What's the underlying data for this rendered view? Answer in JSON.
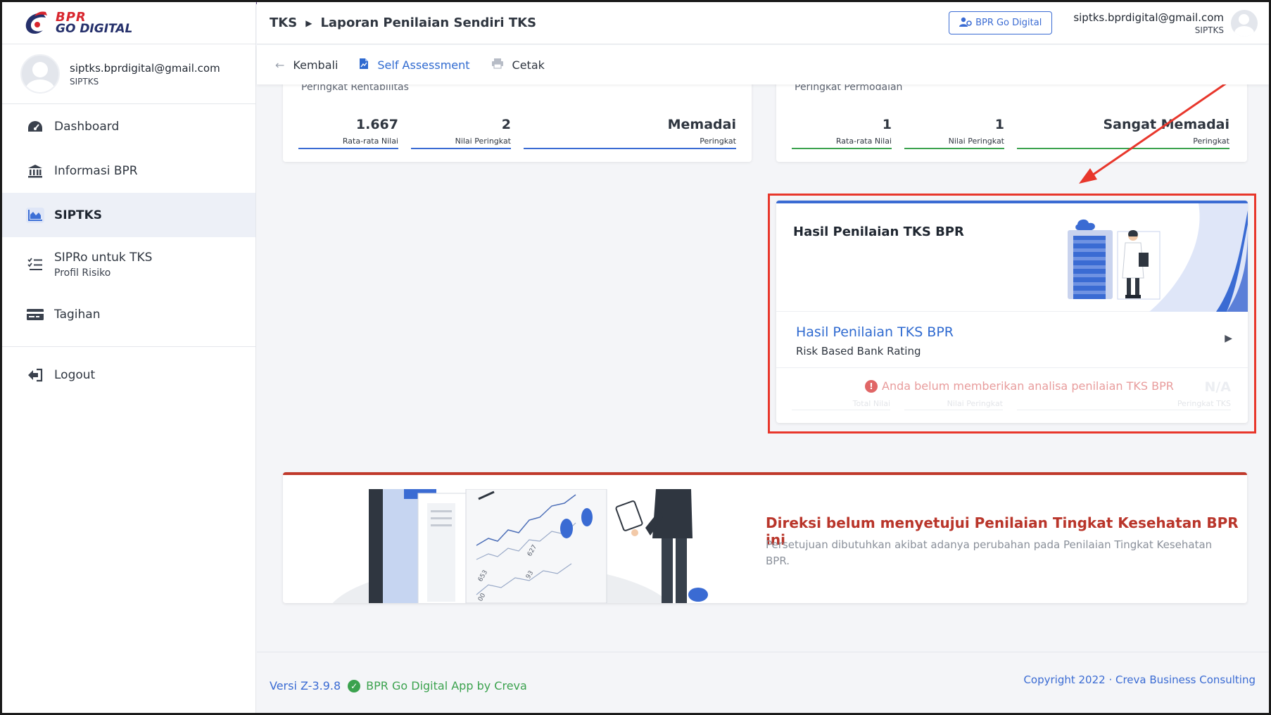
{
  "brand": {
    "line1": "BPR",
    "line2": "GO DIGITAL",
    "accent": "#d8262e",
    "navy": "#25306b"
  },
  "profile": {
    "email": "siptks.bprdigital@gmail.com",
    "role": "SIPTKS"
  },
  "sidebar": {
    "items": [
      {
        "label": "Dashboard",
        "icon": "dashboard-icon"
      },
      {
        "label": "Informasi BPR",
        "icon": "bank-icon"
      },
      {
        "label": "SIPTKS",
        "icon": "chart-area-icon",
        "active": true
      },
      {
        "label": "SIPRo untuk TKS",
        "sub": "Profil Risiko",
        "icon": "checklist-icon"
      },
      {
        "label": "Tagihan",
        "icon": "billing-card-icon"
      }
    ],
    "logout": "Logout"
  },
  "header": {
    "crumb_root": "TKS",
    "crumb_page": "Laporan Penilaian Sendiri TKS",
    "app_button": "BPR Go Digital",
    "user_email": "siptks.bprdigital@gmail.com",
    "user_role": "SIPTKS"
  },
  "toolbar": {
    "back": "Kembali",
    "self_assessment": "Self Assessment",
    "print": "Cetak"
  },
  "rentabilitas": {
    "title": "Peringkat Rentabilitas",
    "avg": "1.667",
    "avg_label": "Rata-rata Nilai",
    "score": "2",
    "score_label": "Nilai Peringkat",
    "rating": "Memadai",
    "rating_label": "Peringkat"
  },
  "permodalan": {
    "title": "Peringkat Permodalan",
    "avg": "1",
    "avg_label": "Rata-rata Nilai",
    "score": "1",
    "score_label": "Nilai Peringkat",
    "rating": "Sangat Memadai",
    "rating_label": "Peringkat"
  },
  "hasil": {
    "title": "Hasil Penilaian TKS BPR",
    "link": "Hasil Penilaian TKS BPR",
    "link_sub": "Risk Based Bank Rating",
    "warning": "Anda belum memberikan analisa penilaian TKS BPR",
    "ghost_total": "Total Nilai",
    "ghost_score": "Nilai Peringkat",
    "ghost_rating": "Peringkat TKS",
    "ghost_na": "N/A"
  },
  "approval": {
    "title": "Direksi belum menyetujui Penilaian Tingkat Kesehatan BPR ini",
    "desc": "Persetujuan dibutuhkan akibat adanya perubahan pada Penilaian Tingkat Kesehatan BPR.",
    "chart_labels": [
      "653",
      "627",
      "93",
      "00"
    ]
  },
  "footer": {
    "version": "Versi Z-3.9.8",
    "app": "BPR Go Digital App by Creva",
    "copyright": "Copyright 2022 · Creva Business Consulting"
  },
  "colors": {
    "primary": "#3a6bd3",
    "success": "#3ba24e",
    "danger": "#c0392b",
    "annotation": "#e8372c"
  }
}
